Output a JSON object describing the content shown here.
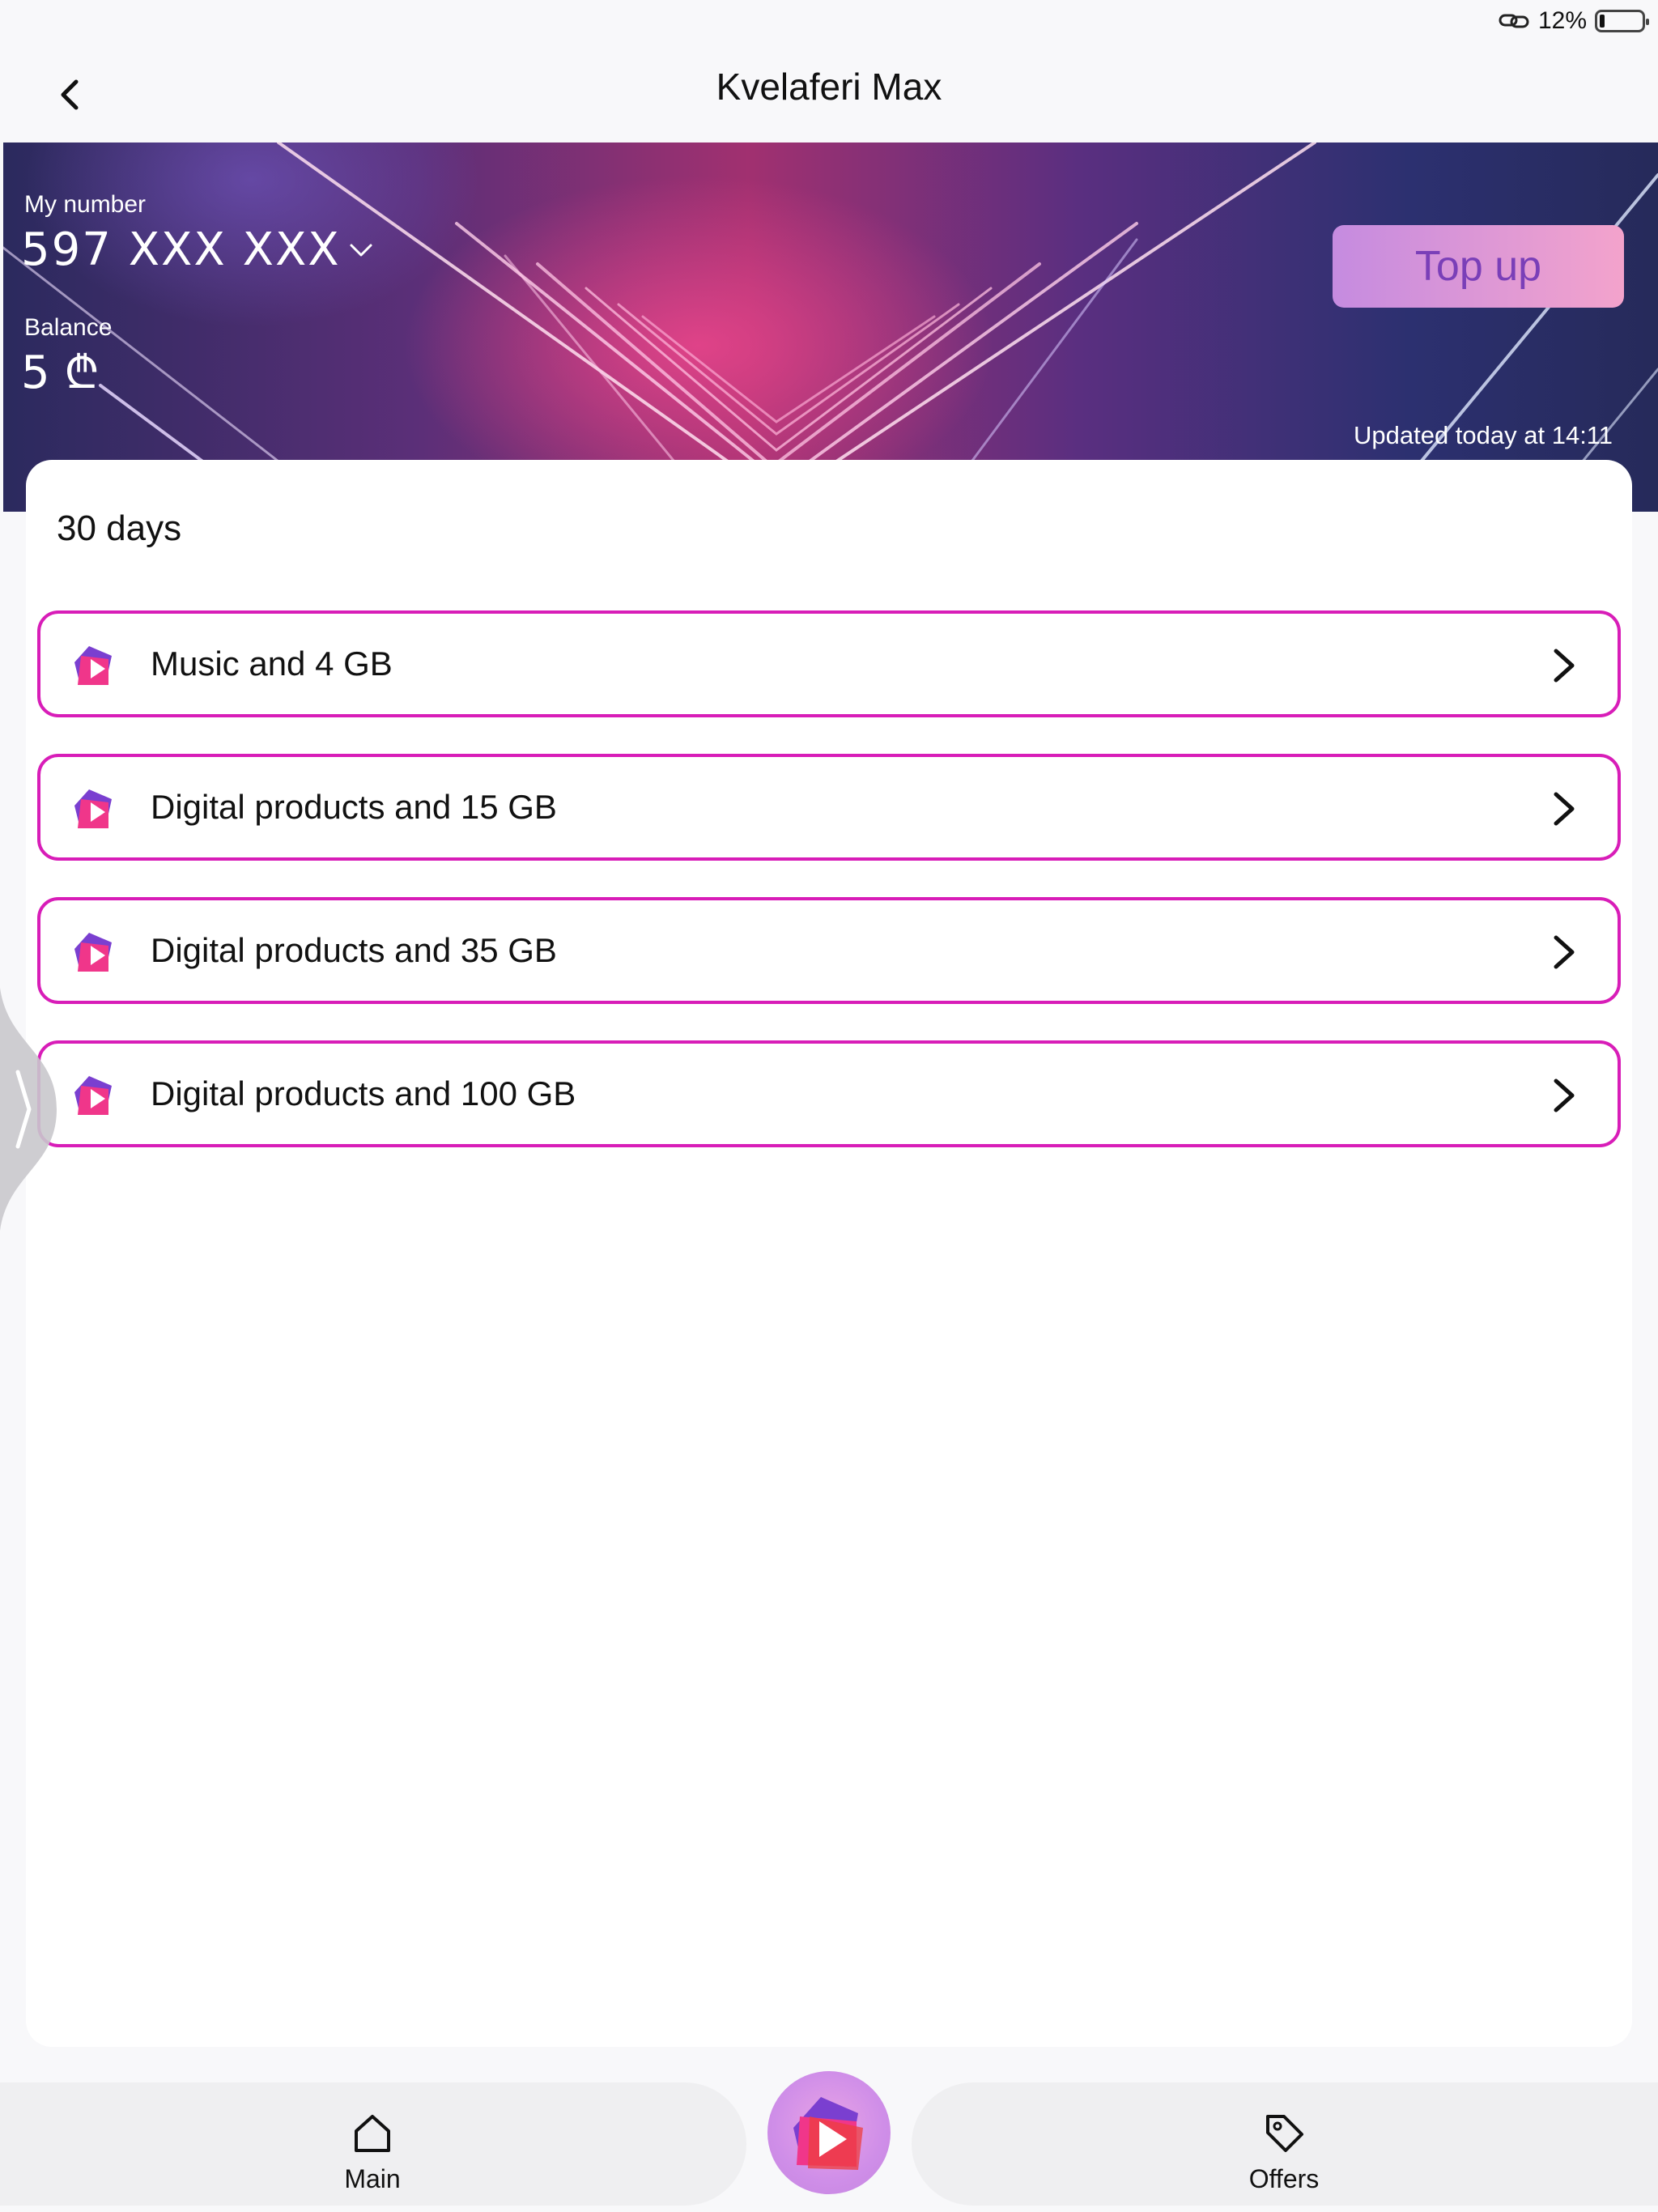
{
  "status_bar": {
    "battery_percent": "12%",
    "battery_level": 0.12,
    "link_icon": "link-icon"
  },
  "header": {
    "title": "Kvelaferi Max",
    "back_icon": "chevron-left-icon"
  },
  "account": {
    "my_number_label": "My number",
    "number": "597 XXX XXX",
    "balance_label": "Balance",
    "balance": "5 ₾",
    "top_up_label": "Top up",
    "updated_text": "Updated today at 14:11"
  },
  "offers_section": {
    "title": "30 days",
    "items": [
      {
        "label": "Music and 4 GB"
      },
      {
        "label": "Digital products and 15 GB"
      },
      {
        "label": "Digital products and 35 GB"
      },
      {
        "label": "Digital products and 100 GB"
      }
    ]
  },
  "bottom_nav": {
    "main_label": "Main",
    "offers_label": "Offers",
    "center_icon": "play-logo-icon"
  },
  "colors": {
    "accent_border": "#d81db8",
    "top_up_text": "#7a3fb8"
  }
}
